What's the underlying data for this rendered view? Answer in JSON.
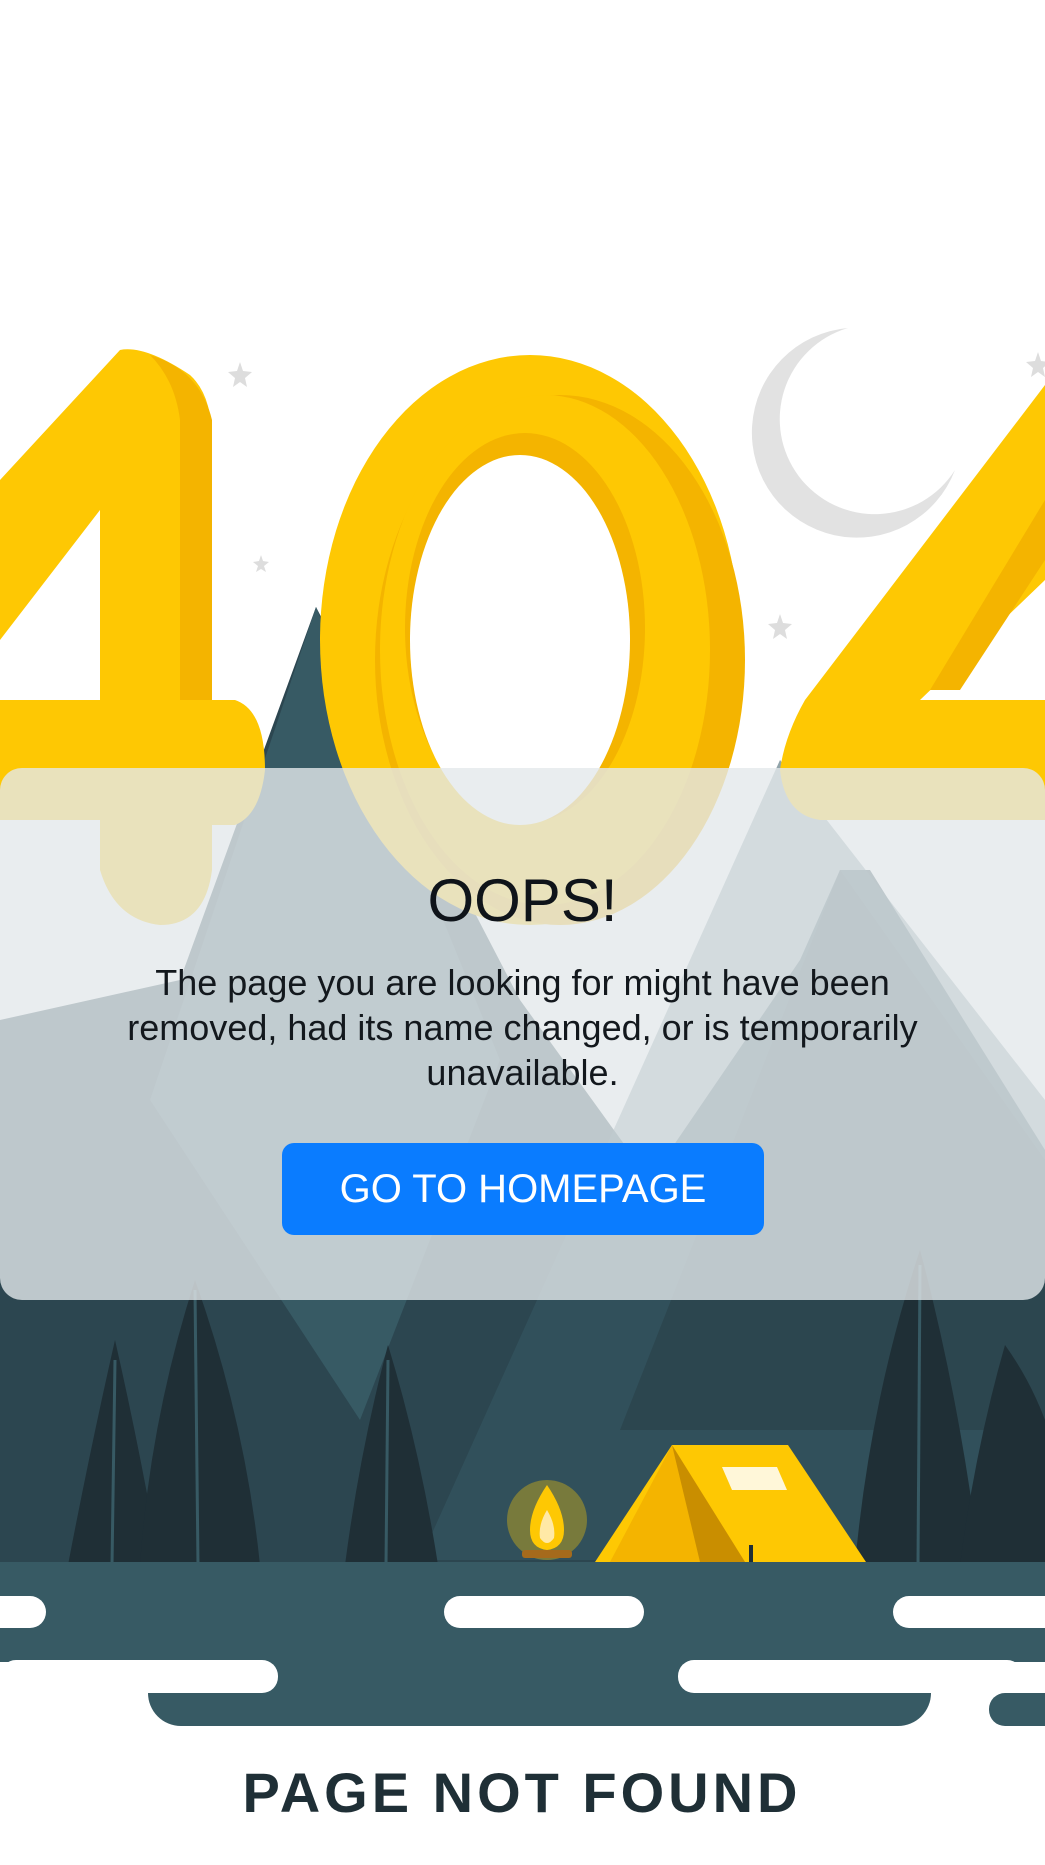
{
  "illustration": {
    "digits": [
      "4",
      "0",
      "4"
    ],
    "caption": "PAGE NOT FOUND",
    "colors": {
      "digit_yellow": "#FEC803",
      "digit_shade": "#F4B400",
      "mountain_dark": "#2C4650",
      "mountain_mid": "#375A64",
      "tree_dark": "#1F2F36",
      "moon": "#E0E0E0",
      "tent": "#FEC803",
      "caption": "#1F2F36"
    }
  },
  "card": {
    "title": "OOPS!",
    "message": "The page you are looking for might have been removed, had its name changed, or is temporarily unavailable.",
    "button_label": "GO TO HOMEPAGE",
    "button_color": "#0A7CFF"
  }
}
